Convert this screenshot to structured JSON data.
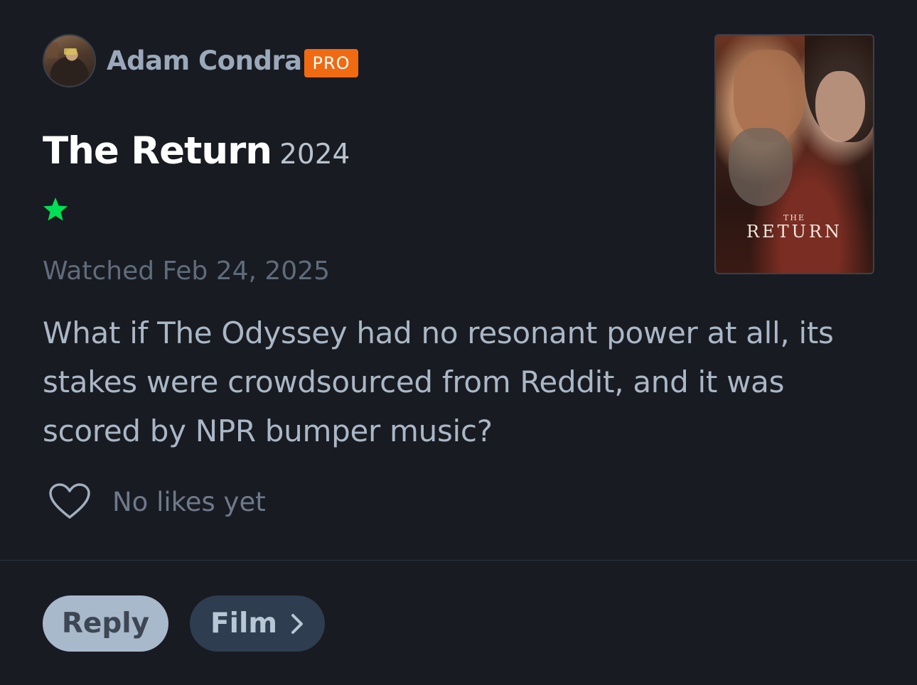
{
  "user": {
    "name": "Adam Condra",
    "badge": "PRO"
  },
  "film": {
    "title": "The Return",
    "year": "2024",
    "poster_small_text": "THE",
    "poster_title": "RETURN"
  },
  "rating": {
    "stars": 0.5,
    "max": 5,
    "color": "#00e054"
  },
  "watched": "Watched Feb 24, 2025",
  "review": "What if The Odyssey had no resonant power at all, its stakes were crowdsourced from Reddit, and it was scored by NPR bumper music?",
  "likes": {
    "label": "No likes yet",
    "icon": "heart-icon"
  },
  "actions": {
    "reply": "Reply",
    "film": "Film",
    "film_icon": "chevron-right-icon"
  },
  "colors": {
    "background": "#181b21",
    "pro_badge": "#f06a12",
    "reply_button": "#a9b9cc",
    "film_button": "#2e3e50"
  }
}
